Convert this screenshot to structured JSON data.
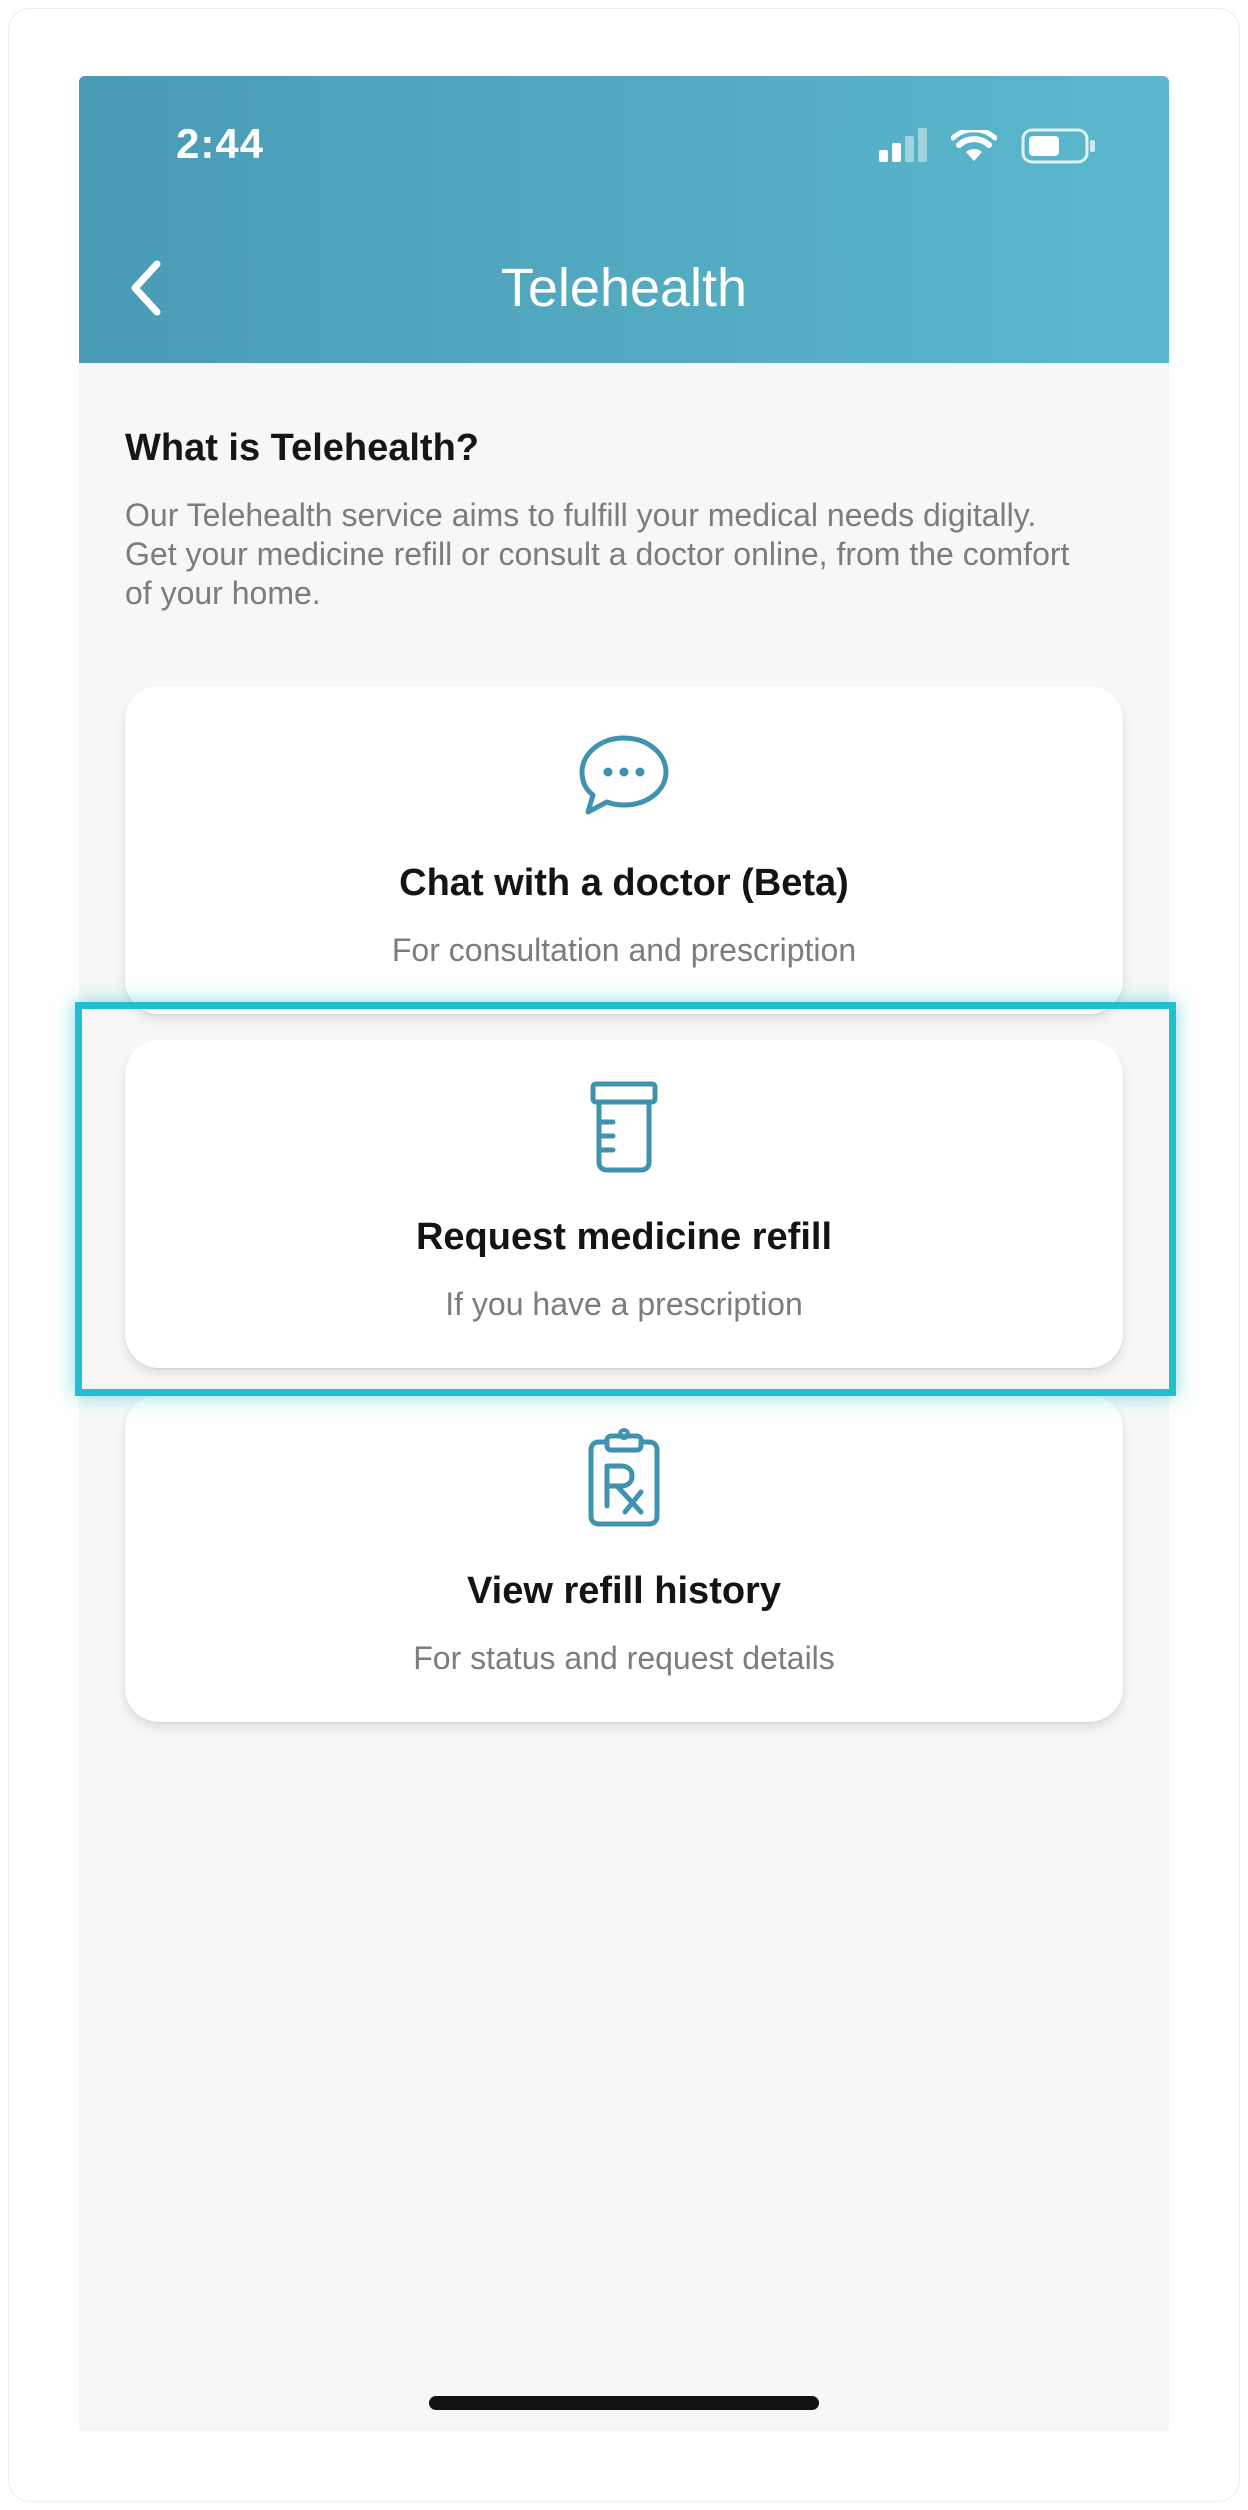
{
  "status_bar": {
    "time": "2:44",
    "icons": [
      "cellular-signal-icon",
      "wifi-icon",
      "battery-icon"
    ]
  },
  "header": {
    "title": "Telehealth",
    "back_icon": "chevron-left-icon"
  },
  "intro": {
    "heading": "What is Telehealth?",
    "text": "Our Telehealth service aims to fulfill your medical needs digitally. Get your medicine refill or consult a doctor online, from the comfort of your home."
  },
  "options": [
    {
      "icon": "chat-bubble-icon",
      "title": "Chat with a doctor (Beta)",
      "subtitle": "For consultation and prescription"
    },
    {
      "icon": "pill-bottle-icon",
      "title": "Request medicine refill",
      "subtitle": "If you have a prescription"
    },
    {
      "icon": "prescription-clipboard-icon",
      "title": "View refill history",
      "subtitle": "For status and request details"
    }
  ],
  "colors": {
    "header_gradient_start": "#4a9bb5",
    "header_gradient_end": "#5bb8cc",
    "icon_color": "#3f93b1",
    "highlight": "#23bfd0"
  }
}
